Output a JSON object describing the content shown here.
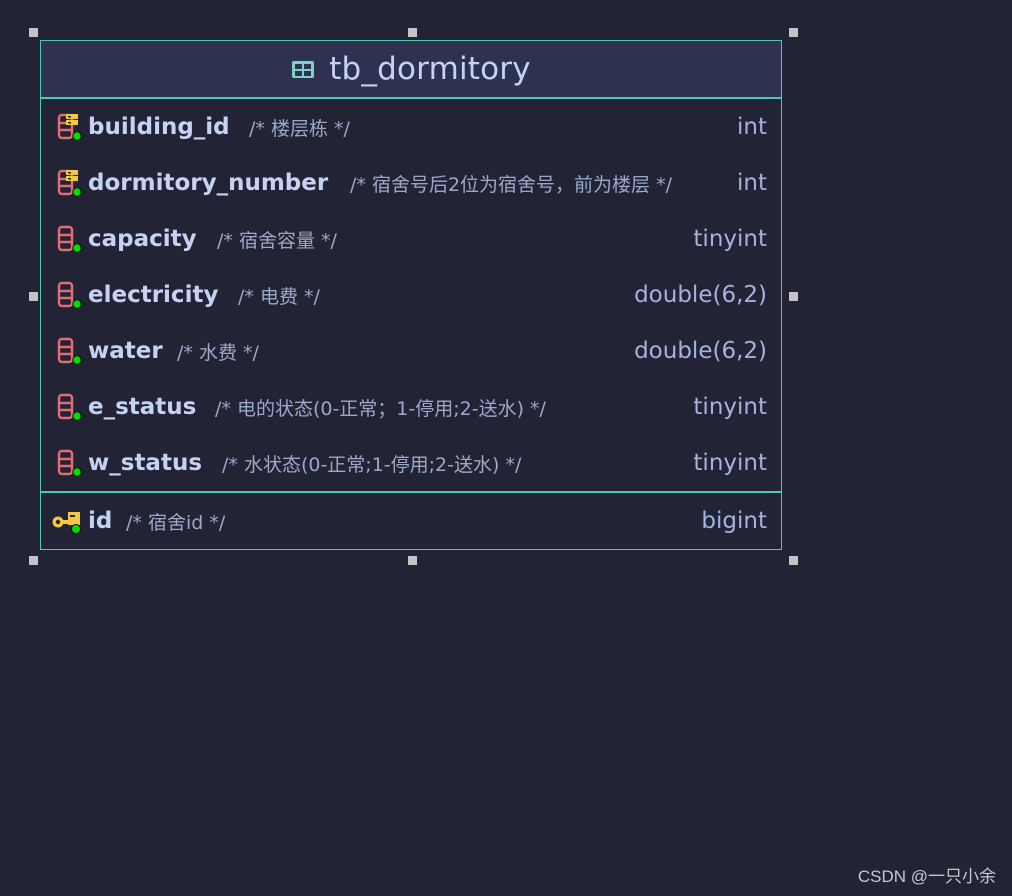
{
  "table": {
    "name": "tb_dormitory",
    "icon": "table-icon",
    "columns": [
      {
        "name": "building_id",
        "comment": "/* 楼层栋 */",
        "type": "int",
        "icon": "foreign-key-column-icon",
        "not_null": true
      },
      {
        "name": "dormitory_number",
        "comment": "/* 宿舍号后2位为宿舍号，前为楼层 */",
        "type": "int",
        "icon": "foreign-key-column-icon",
        "not_null": true
      },
      {
        "name": "capacity",
        "comment": "/* 宿舍容量 */",
        "type": "tinyint",
        "icon": "column-icon",
        "not_null": true
      },
      {
        "name": "electricity",
        "comment": "/* 电费 */",
        "type": "double(6,2)",
        "icon": "column-icon",
        "not_null": true
      },
      {
        "name": "water",
        "comment": "/* 水费 */",
        "type": "double(6,2)",
        "icon": "column-icon",
        "not_null": true
      },
      {
        "name": "e_status",
        "comment": "/* 电的状态(0-正常；1-停用;2-送水) */",
        "type": "tinyint",
        "icon": "column-icon",
        "not_null": true
      },
      {
        "name": "w_status",
        "comment": "/* 水状态(0-正常;1-停用;2-送水) */",
        "type": "tinyint",
        "icon": "column-icon",
        "not_null": true
      }
    ],
    "primary_keys": [
      {
        "name": "id",
        "comment": "/* 宿舍id */",
        "type": "bigint",
        "icon": "primary-key-icon",
        "not_null": true
      }
    ]
  },
  "colors": {
    "border": "#4ec9b0",
    "header_bg": "#2e3150",
    "canvas_bg": "#222334",
    "column_icon": "#e06c75",
    "key_icon": "#f5c842",
    "not_null_dot": "#00e000"
  },
  "watermark": "CSDN @一只小余"
}
